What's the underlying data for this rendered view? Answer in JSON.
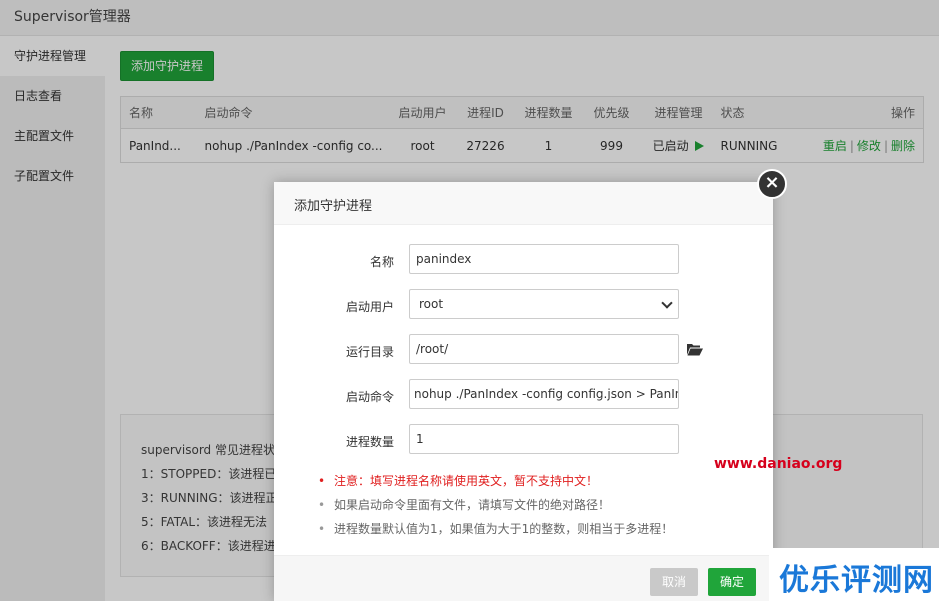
{
  "app": {
    "title": "Supervisor管理器"
  },
  "sidebar": {
    "items": [
      {
        "label": "守护进程管理"
      },
      {
        "label": "日志查看"
      },
      {
        "label": "主配置文件"
      },
      {
        "label": "子配置文件"
      }
    ]
  },
  "toolbar": {
    "add_label": "添加守护进程"
  },
  "table": {
    "headers": [
      "名称",
      "启动命令",
      "启动用户",
      "进程ID",
      "进程数量",
      "优先级",
      "进程管理",
      "状态",
      "操作"
    ],
    "rows": [
      {
        "name": "PanInd...",
        "command": "nohup ./PanIndex -config co...",
        "user": "root",
        "pid": "27226",
        "count": "1",
        "priority": "999",
        "manage": "已启动",
        "status": "RUNNING",
        "actions": {
          "restart": "重启",
          "edit": "修改",
          "delete": "删除"
        }
      }
    ]
  },
  "tips": {
    "lines": [
      "supervisord 常见进程状态",
      "1：STOPPED：该进程已",
      "3：RUNNING：该进程正",
      "5：FATAL：该进程无法",
      "6：BACKOFF：该进程进"
    ]
  },
  "modal": {
    "title": "添加守护进程",
    "close_glyph": "×",
    "fields": {
      "name": {
        "label": "名称",
        "value": "panindex"
      },
      "user": {
        "label": "启动用户",
        "value": "root"
      },
      "dir": {
        "label": "运行目录",
        "value": "/root/"
      },
      "command": {
        "label": "启动命令",
        "value": "nohup ./PanIndex -config config.json > PanIn"
      },
      "count": {
        "label": "进程数量",
        "value": "1"
      }
    },
    "notes": [
      "注意：填写进程名称请使用英文，暂不支持中文！",
      "如果启动命令里面有文件，请填写文件的绝对路径！",
      "进程数量默认值为1，如果值为大于1的整数，则相当于多进程！"
    ],
    "cancel_label": "取消",
    "ok_label": "确定"
  },
  "watermark": {
    "url": "www.daniao.org",
    "logo_text": "优乐评测网"
  },
  "colors": {
    "accent": "#20a53a",
    "danger": "#e02020",
    "watermark_red": "#d6001c",
    "logo_blue": "#1a78d8"
  },
  "icons": {
    "running": "play-triangle-icon",
    "folder": "folder-open-icon",
    "close": "close-icon",
    "select": "chevron-down-icon"
  }
}
